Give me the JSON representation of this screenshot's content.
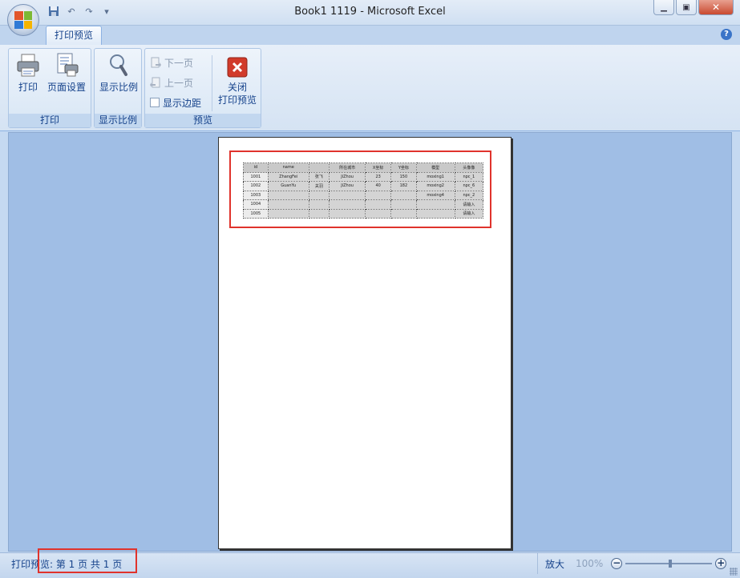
{
  "window": {
    "title": "Book1 1119 - Microsoft Excel"
  },
  "quick_access": {
    "items": [
      "save-icon",
      "undo-icon",
      "redo-icon",
      "customize-icon"
    ]
  },
  "tabs": [
    {
      "label": "打印预览"
    }
  ],
  "ribbon": {
    "groups": {
      "print": {
        "label": "打印",
        "print_button": "打印",
        "page_setup_button": "页面设置"
      },
      "zoom": {
        "label": "显示比例",
        "zoom_button": "显示比例"
      },
      "preview": {
        "label": "预览",
        "next_page": "下一页",
        "prev_page": "上一页",
        "show_margins": "显示边距",
        "close_preview_line1": "关闭",
        "close_preview_line2": "打印预览"
      }
    }
  },
  "sheet": {
    "headers": [
      "id",
      "name",
      "",
      "所在城市",
      "X坐标",
      "Y坐标",
      "模型",
      "头像像"
    ],
    "rows": [
      [
        "1001",
        "ZhangFei",
        "张飞",
        "JiZhou",
        "23",
        "150",
        "moxing1",
        "npc_1"
      ],
      [
        "1002",
        "GuanYu",
        "关羽",
        "JiZhou",
        "40",
        "182",
        "moxing2",
        "npc_6"
      ],
      [
        "1003",
        "",
        "",
        "",
        "",
        "",
        "moxing4",
        "npc_2"
      ],
      [
        "1004",
        "",
        "",
        "",
        "",
        "",
        "",
        "请输入"
      ],
      [
        "1005",
        "",
        "",
        "",
        "",
        "",
        "",
        "请输入"
      ]
    ]
  },
  "status": {
    "page_info": "打印预览: 第 1 页  共 1 页",
    "zoom_label": "放大",
    "zoom_value": "100%"
  },
  "colors": {
    "highlight": "#e0332c",
    "ribbon_text": "#15428b",
    "close_icon": "#d13b2b"
  }
}
